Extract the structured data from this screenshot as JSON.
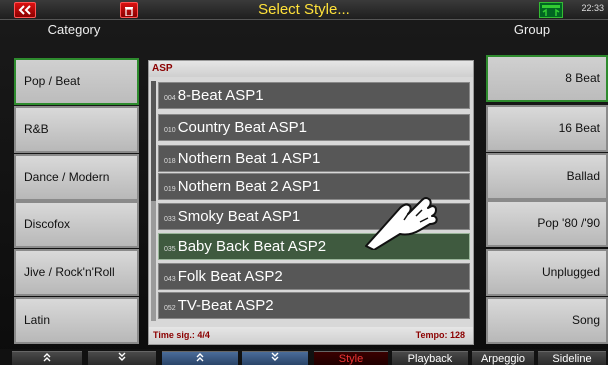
{
  "header": {
    "title": "Select Style...",
    "clock": "22:33"
  },
  "columns": {
    "category": "Category",
    "group": "Group"
  },
  "categories": [
    {
      "label": "Pop / Beat",
      "selected": true
    },
    {
      "label": "R&B",
      "selected": false
    },
    {
      "label": "Dance / Modern",
      "selected": false
    },
    {
      "label": "Discofox",
      "selected": false
    },
    {
      "label": "Jive / Rock'n'Roll",
      "selected": false
    },
    {
      "label": "Latin",
      "selected": false
    }
  ],
  "groups": [
    {
      "label": "8 Beat",
      "selected": true
    },
    {
      "label": "16 Beat",
      "selected": false
    },
    {
      "label": "Ballad",
      "selected": false
    },
    {
      "label": "Pop '80 /'90",
      "selected": false
    },
    {
      "label": "Unplugged",
      "selected": false
    },
    {
      "label": "Song",
      "selected": false
    }
  ],
  "list": {
    "header": "ASP",
    "items": [
      {
        "num": "004",
        "name": "8-Beat ASP1",
        "selected": false
      },
      {
        "num": "010",
        "name": "Country Beat ASP1",
        "selected": false
      },
      {
        "num": "018",
        "name": "Nothern Beat 1 ASP1",
        "selected": false
      },
      {
        "num": "019",
        "name": "Nothern Beat 2 ASP1",
        "selected": false
      },
      {
        "num": "033",
        "name": "Smoky Beat ASP1",
        "selected": false
      },
      {
        "num": "035",
        "name": "Baby Back Beat ASP2",
        "selected": true
      },
      {
        "num": "043",
        "name": "Folk Beat ASP2",
        "selected": false
      },
      {
        "num": "052",
        "name": "TV-Beat ASP2",
        "selected": false
      }
    ],
    "time_sig": "Time sig.: 4/4",
    "tempo": "Tempo: 128"
  },
  "bottom": {
    "style": "Style",
    "playback": "Playback",
    "arpeggio": "Arpeggio",
    "sideline": "Sideline"
  },
  "colors": {
    "title": "#ffe13a",
    "selected_border": "#2e8b2e",
    "selected_row": "#3f5a3f",
    "list_accent": "#8b0000"
  }
}
